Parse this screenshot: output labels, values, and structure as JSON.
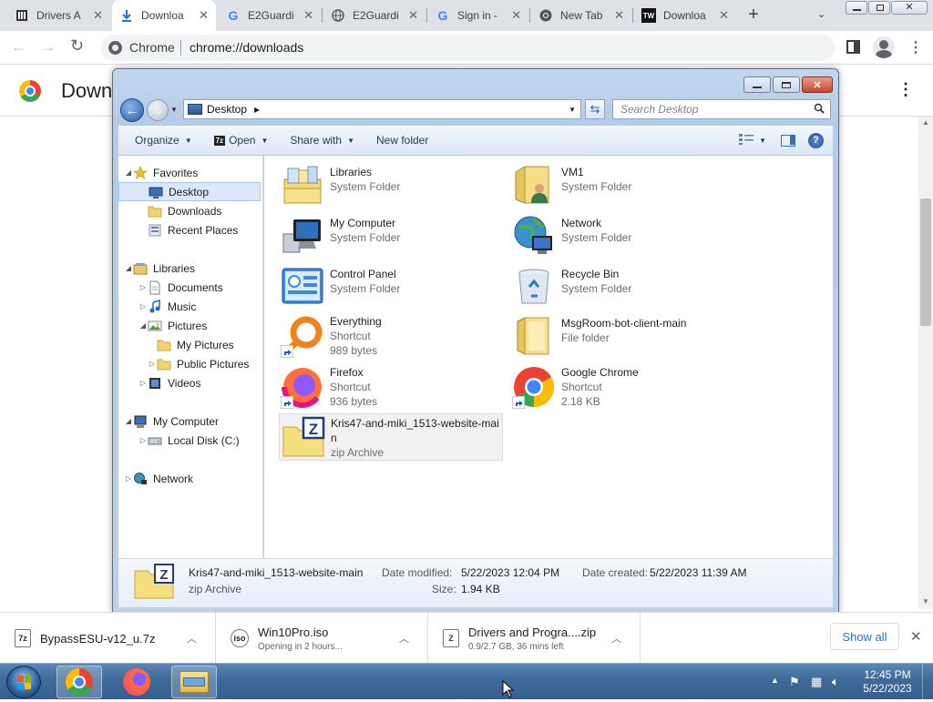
{
  "browser": {
    "tabs": [
      {
        "title": "Drivers A",
        "icon": "page-icon"
      },
      {
        "title": "Downloa",
        "icon": "download-icon"
      },
      {
        "title": "E2Guardi",
        "icon": "google-g-icon"
      },
      {
        "title": "E2Guardi",
        "icon": "globe-icon"
      },
      {
        "title": "Sign in - ",
        "icon": "google-g-icon"
      },
      {
        "title": "New Tab",
        "icon": "chrome-icon"
      },
      {
        "title": "Downloa",
        "icon": "tw-icon"
      }
    ],
    "omnibox_site": "Chrome",
    "omnibox_url": "chrome://downloads",
    "page_title": "Down"
  },
  "explorer": {
    "address_location": "Desktop",
    "search_placeholder": "Search Desktop",
    "commands": {
      "organize": "Organize",
      "open": "Open",
      "open_badge": "7z",
      "share_with": "Share with",
      "new_folder": "New folder"
    },
    "nav": [
      {
        "label": "Favorites",
        "icon": "star-icon",
        "level": 0,
        "arrow": "expanded"
      },
      {
        "label": "Desktop",
        "icon": "desktop-icon",
        "level": 1,
        "arrow": "",
        "selected": true
      },
      {
        "label": "Downloads",
        "icon": "folder-icon",
        "level": 1,
        "arrow": ""
      },
      {
        "label": "Recent Places",
        "icon": "recent-icon",
        "level": 1,
        "arrow": ""
      },
      {
        "label": "Libraries",
        "icon": "library-icon",
        "level": 0,
        "arrow": "expanded"
      },
      {
        "label": "Documents",
        "icon": "document-icon",
        "level": 1,
        "arrow": "collapsed"
      },
      {
        "label": "Music",
        "icon": "music-icon",
        "level": 1,
        "arrow": "collapsed"
      },
      {
        "label": "Pictures",
        "icon": "picture-icon",
        "level": 1,
        "arrow": "expanded"
      },
      {
        "label": "My Pictures",
        "icon": "folder-icon",
        "level": 2,
        "arrow": ""
      },
      {
        "label": "Public Pictures",
        "icon": "folder-icon",
        "level": 2,
        "arrow": "collapsed"
      },
      {
        "label": "Videos",
        "icon": "video-icon",
        "level": 1,
        "arrow": "collapsed"
      },
      {
        "label": "My Computer",
        "icon": "computer-icon",
        "level": 0,
        "arrow": "expanded"
      },
      {
        "label": "Local Disk (C:)",
        "icon": "disk-icon",
        "level": 1,
        "arrow": "collapsed"
      },
      {
        "label": "Network",
        "icon": "network-icon",
        "level": 0,
        "arrow": "collapsed"
      }
    ],
    "items": [
      {
        "name": "Libraries",
        "type": "System Folder",
        "size": "",
        "icon": "libraries-icon"
      },
      {
        "name": "VM1",
        "type": "System Folder",
        "size": "",
        "icon": "user-folder-icon"
      },
      {
        "name": "My Computer",
        "type": "System Folder",
        "size": "",
        "icon": "computer-icon"
      },
      {
        "name": "Network",
        "type": "System Folder",
        "size": "",
        "icon": "network-globe-icon"
      },
      {
        "name": "Control Panel",
        "type": "System Folder",
        "size": "",
        "icon": "control-panel-icon"
      },
      {
        "name": "Recycle Bin",
        "type": "System Folder",
        "size": "",
        "icon": "recycle-bin-icon"
      },
      {
        "name": "Everything",
        "type": "Shortcut",
        "size": "989 bytes",
        "icon": "everything-search-icon"
      },
      {
        "name": "MsgRoom-bot-client-main",
        "type": "File folder",
        "size": "",
        "icon": "folder-icon"
      },
      {
        "name": "Firefox",
        "type": "Shortcut",
        "size": "936 bytes",
        "icon": "firefox-icon"
      },
      {
        "name": "Google Chrome",
        "type": "Shortcut",
        "size": "2.18 KB",
        "icon": "chrome-icon"
      },
      {
        "name": "Kris47-and-miki_1513-website-main",
        "type": "zip Archive",
        "size": "",
        "icon": "zip-archive-icon"
      }
    ],
    "details": {
      "name": "Kris47-and-miki_1513-website-main",
      "type": "zip Archive",
      "modified_label": "Date modified:",
      "modified": "5/22/2023 12:04 PM",
      "created_label": "Date created:",
      "created": "5/22/2023 11:39 AM",
      "size_label": "Size:",
      "size": "1.94 KB"
    }
  },
  "downloads": [
    {
      "name": "BypassESU-v12_u.7z",
      "status": "",
      "badge": "7z"
    },
    {
      "name": "Win10Pro.iso",
      "status": "Opening in 2 hours...",
      "badge": "iso"
    },
    {
      "name": "Drivers and Progra....zip",
      "status": "0.9/2.7 GB, 36 mins left",
      "badge": "Z"
    }
  ],
  "shelf": {
    "show_all": "Show all"
  },
  "taskbar": {
    "time": "12:45 PM",
    "date": "5/22/2023"
  }
}
